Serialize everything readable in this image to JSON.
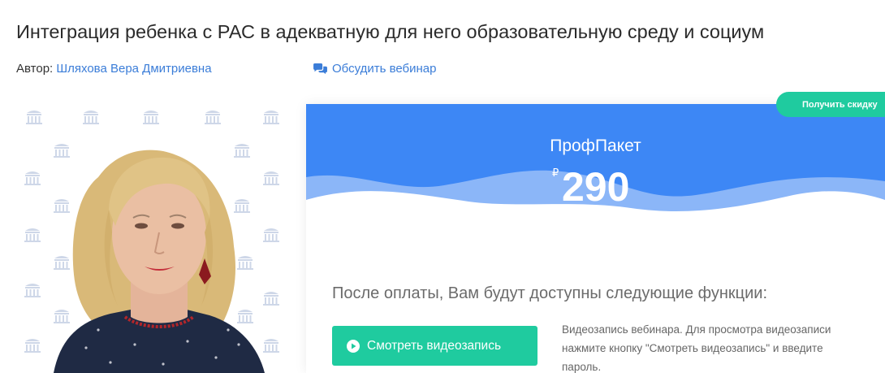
{
  "webinar": {
    "title": "Интеграция ребенка с РАС в адекватную для него образовательную среду и социум",
    "author_label": "Автор:",
    "author_name": "Шляхова Вера Дмитриевна",
    "discuss_label": "Обсудить вебинар",
    "discuss_icon": "chat-bubbles-icon"
  },
  "photo": {
    "description_icon": "lecturer-photo"
  },
  "offer": {
    "discount_label": "Получить скидку",
    "plan_name": "ПрофПакет",
    "currency": "₽",
    "price": "290",
    "features_title": "После оплаты, Вам будут доступны следующие функции:",
    "watch_button_label": "Смотреть видеозапись",
    "watch_button_icon": "play-circle-icon",
    "watch_description": "Видеозапись вебинара. Для просмотра видеозаписи нажмите кнопку \"Смотреть видеозапись\" и введите пароль."
  },
  "colors": {
    "accent_blue": "#3b7dd8",
    "header_blue": "#3d87f5",
    "wave_light": "#8bb6f8",
    "green": "#1fcb9f"
  }
}
